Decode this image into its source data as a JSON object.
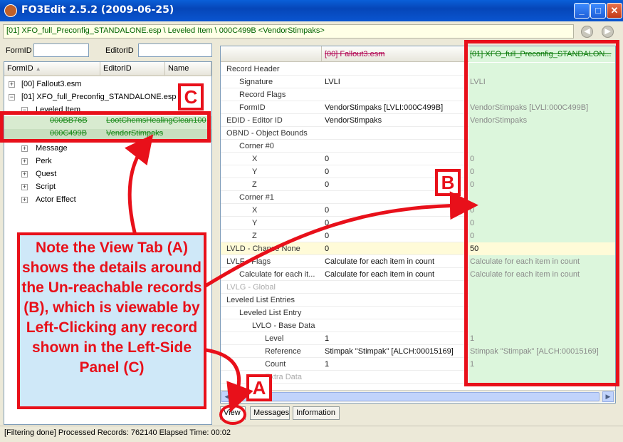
{
  "window": {
    "title": "FO3Edit 2.5.2 (2009-06-25)"
  },
  "pathbar": {
    "text": "[01] XFO_full_Preconfig_STANDALONE.esp \\ Leveled Item \\ 000C499B <VendorStimpaks>"
  },
  "filters": {
    "formid_label": "FormID",
    "editorid_label": "EditorID"
  },
  "left_tree": {
    "columns": [
      "FormID",
      "EditorID",
      "Name"
    ],
    "items": [
      {
        "label": "[00] Fallout3.esm"
      },
      {
        "label": "[01] XFO_full_Preconfig_STANDALONE.esp"
      },
      {
        "label": "Leveled Item"
      },
      {
        "formid": "000BB76B",
        "editorid": "LootChemsHealingClean100"
      },
      {
        "formid": "000C499B",
        "editorid": "VendorStimpaks"
      },
      {
        "label": "Message"
      },
      {
        "label": "Perk"
      },
      {
        "label": "Quest"
      },
      {
        "label": "Script"
      },
      {
        "label": "Actor Effect"
      }
    ]
  },
  "grid": {
    "headers": [
      "",
      "[00] Fallout3.esm",
      "[01] XFO_full_Preconfig_STANDALON..."
    ],
    "rows": [
      [
        "Record Header",
        "",
        ""
      ],
      [
        "Signature",
        "LVLI",
        "LVLI"
      ],
      [
        "Record Flags",
        "",
        ""
      ],
      [
        "FormID",
        "VendorStimpaks [LVLI:000C499B]",
        "VendorStimpaks [LVLI:000C499B]"
      ],
      [
        "EDID - Editor ID",
        "VendorStimpaks",
        "VendorStimpaks"
      ],
      [
        "OBND - Object Bounds",
        "",
        ""
      ],
      [
        "Corner #0",
        "",
        ""
      ],
      [
        "X",
        "0",
        "0"
      ],
      [
        "Y",
        "0",
        "0"
      ],
      [
        "Z",
        "0",
        "0"
      ],
      [
        "Corner #1",
        "",
        ""
      ],
      [
        "X",
        "0",
        "0"
      ],
      [
        "Y",
        "0",
        "0"
      ],
      [
        "Z",
        "0",
        "0"
      ],
      [
        "LVLD - Chance None",
        "0",
        "50"
      ],
      [
        "LVLF - Flags",
        "Calculate for each item in count",
        "Calculate for each item in count"
      ],
      [
        "Calculate for each it...",
        "Calculate for each item in count",
        "Calculate for each item in count"
      ],
      [
        "LVLG - Global",
        "",
        ""
      ],
      [
        "Leveled List Entries",
        "",
        ""
      ],
      [
        "Leveled List Entry",
        "",
        ""
      ],
      [
        "LVLO - Base Data",
        "",
        ""
      ],
      [
        "Level",
        "1",
        "1"
      ],
      [
        "Reference",
        "Stimpak \"Stimpak\" [ALCH:00015169]",
        "Stimpak \"Stimpak\" [ALCH:00015169]"
      ],
      [
        "Count",
        "1",
        "1"
      ],
      [
        "Extra Data",
        "",
        ""
      ]
    ]
  },
  "tabs": [
    "View",
    "Messages",
    "Information"
  ],
  "status": {
    "text": "[Filtering done]  Processed Records: 762140 Elapsed Time: 00:02"
  },
  "annotations": {
    "badge_a": "A",
    "badge_b": "B",
    "badge_c": "C",
    "callout": "Note the View Tab (A) shows the details around the Un-reachable records (B), which is viewable by Left-Clicking any record shown in the Left-Side Panel (C)"
  },
  "colors": {
    "annotation_red": "#e8101a",
    "callout_bg": "#cfe8f8",
    "override_green": "#dcf6dc",
    "highlight_yellow": "#fffbd8"
  }
}
